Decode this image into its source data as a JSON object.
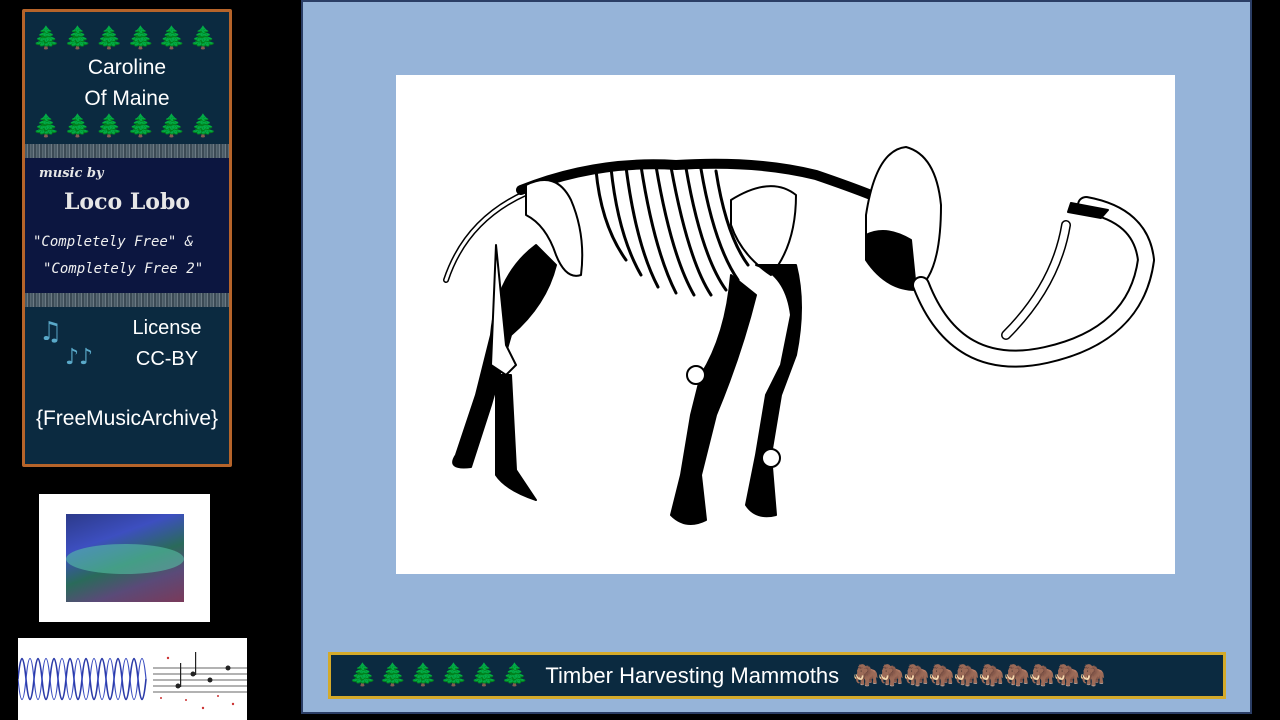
{
  "card": {
    "trees_top": "🌲🌲🌲🌲🌲🌲",
    "title_line1": "Caroline",
    "title_line2": "Of Maine",
    "trees_bottom": "🌲🌲🌲🌲🌲🌲",
    "music_by": "music by",
    "artist": "Loco Lobo",
    "album_line1": "\"Completely Free\" &",
    "album_line2": "\"Completely Free 2\"",
    "note_icon1": "♫",
    "note_icon2": "♪♪",
    "license_label": "License",
    "license_value": "CC-BY",
    "source": "{FreeMusicArchive}"
  },
  "banner": {
    "trees": "🌲🌲🌲🌲🌲🌲",
    "title": "Timber Harvesting Mammoths",
    "mammoths": "🦣🦣🦣🦣🦣🦣🦣🦣🦣🦣"
  },
  "colors": {
    "slide_background": "#96b4d9",
    "card_background": "#0b2a40",
    "card_border": "#b6642a",
    "banner_border": "#d4aa2a"
  }
}
